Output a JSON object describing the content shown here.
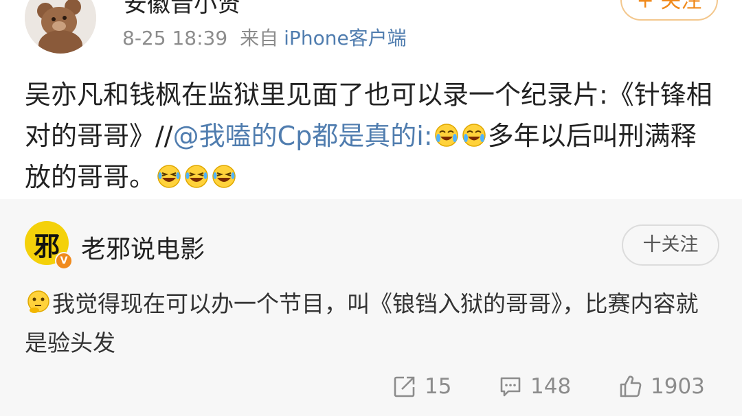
{
  "repost": {
    "username": "安徽音小贤",
    "time": "8-25 18:39",
    "source_prefix": "来自",
    "source": "iPhone客户端",
    "follow_label": "+ 关注",
    "text_part1": "吴亦凡和钱枫在监狱里见面了也可以录一个纪录片:《针锋相对的哥哥》//",
    "mention": "@我嗑的Cp都是真的i:",
    "text_part2": "多年以后叫刑满释放的哥哥。"
  },
  "original": {
    "username": "老邪说电影",
    "avatar_glyph": "邪",
    "verified_badge": "V",
    "follow_label": "十关注",
    "text": "我觉得现在可以办一个节目，叫《锒铛入狱的哥哥》，比赛内容就是验头发"
  },
  "actions": {
    "share_count": "15",
    "comment_count": "148",
    "like_count": "1903"
  },
  "icons": {
    "cry_emoji": "crying-laugh-emoji",
    "laugh_emoji": "laughing-emoji",
    "think_emoji": "thinking-emoji",
    "share": "share-icon",
    "comment": "comment-icon",
    "like": "thumbs-up-icon"
  },
  "colors": {
    "link": "#507daf",
    "follow_orange": "#f08a1c",
    "muted": "#8c8c8c",
    "quoted_bg": "#f7f7f7"
  }
}
